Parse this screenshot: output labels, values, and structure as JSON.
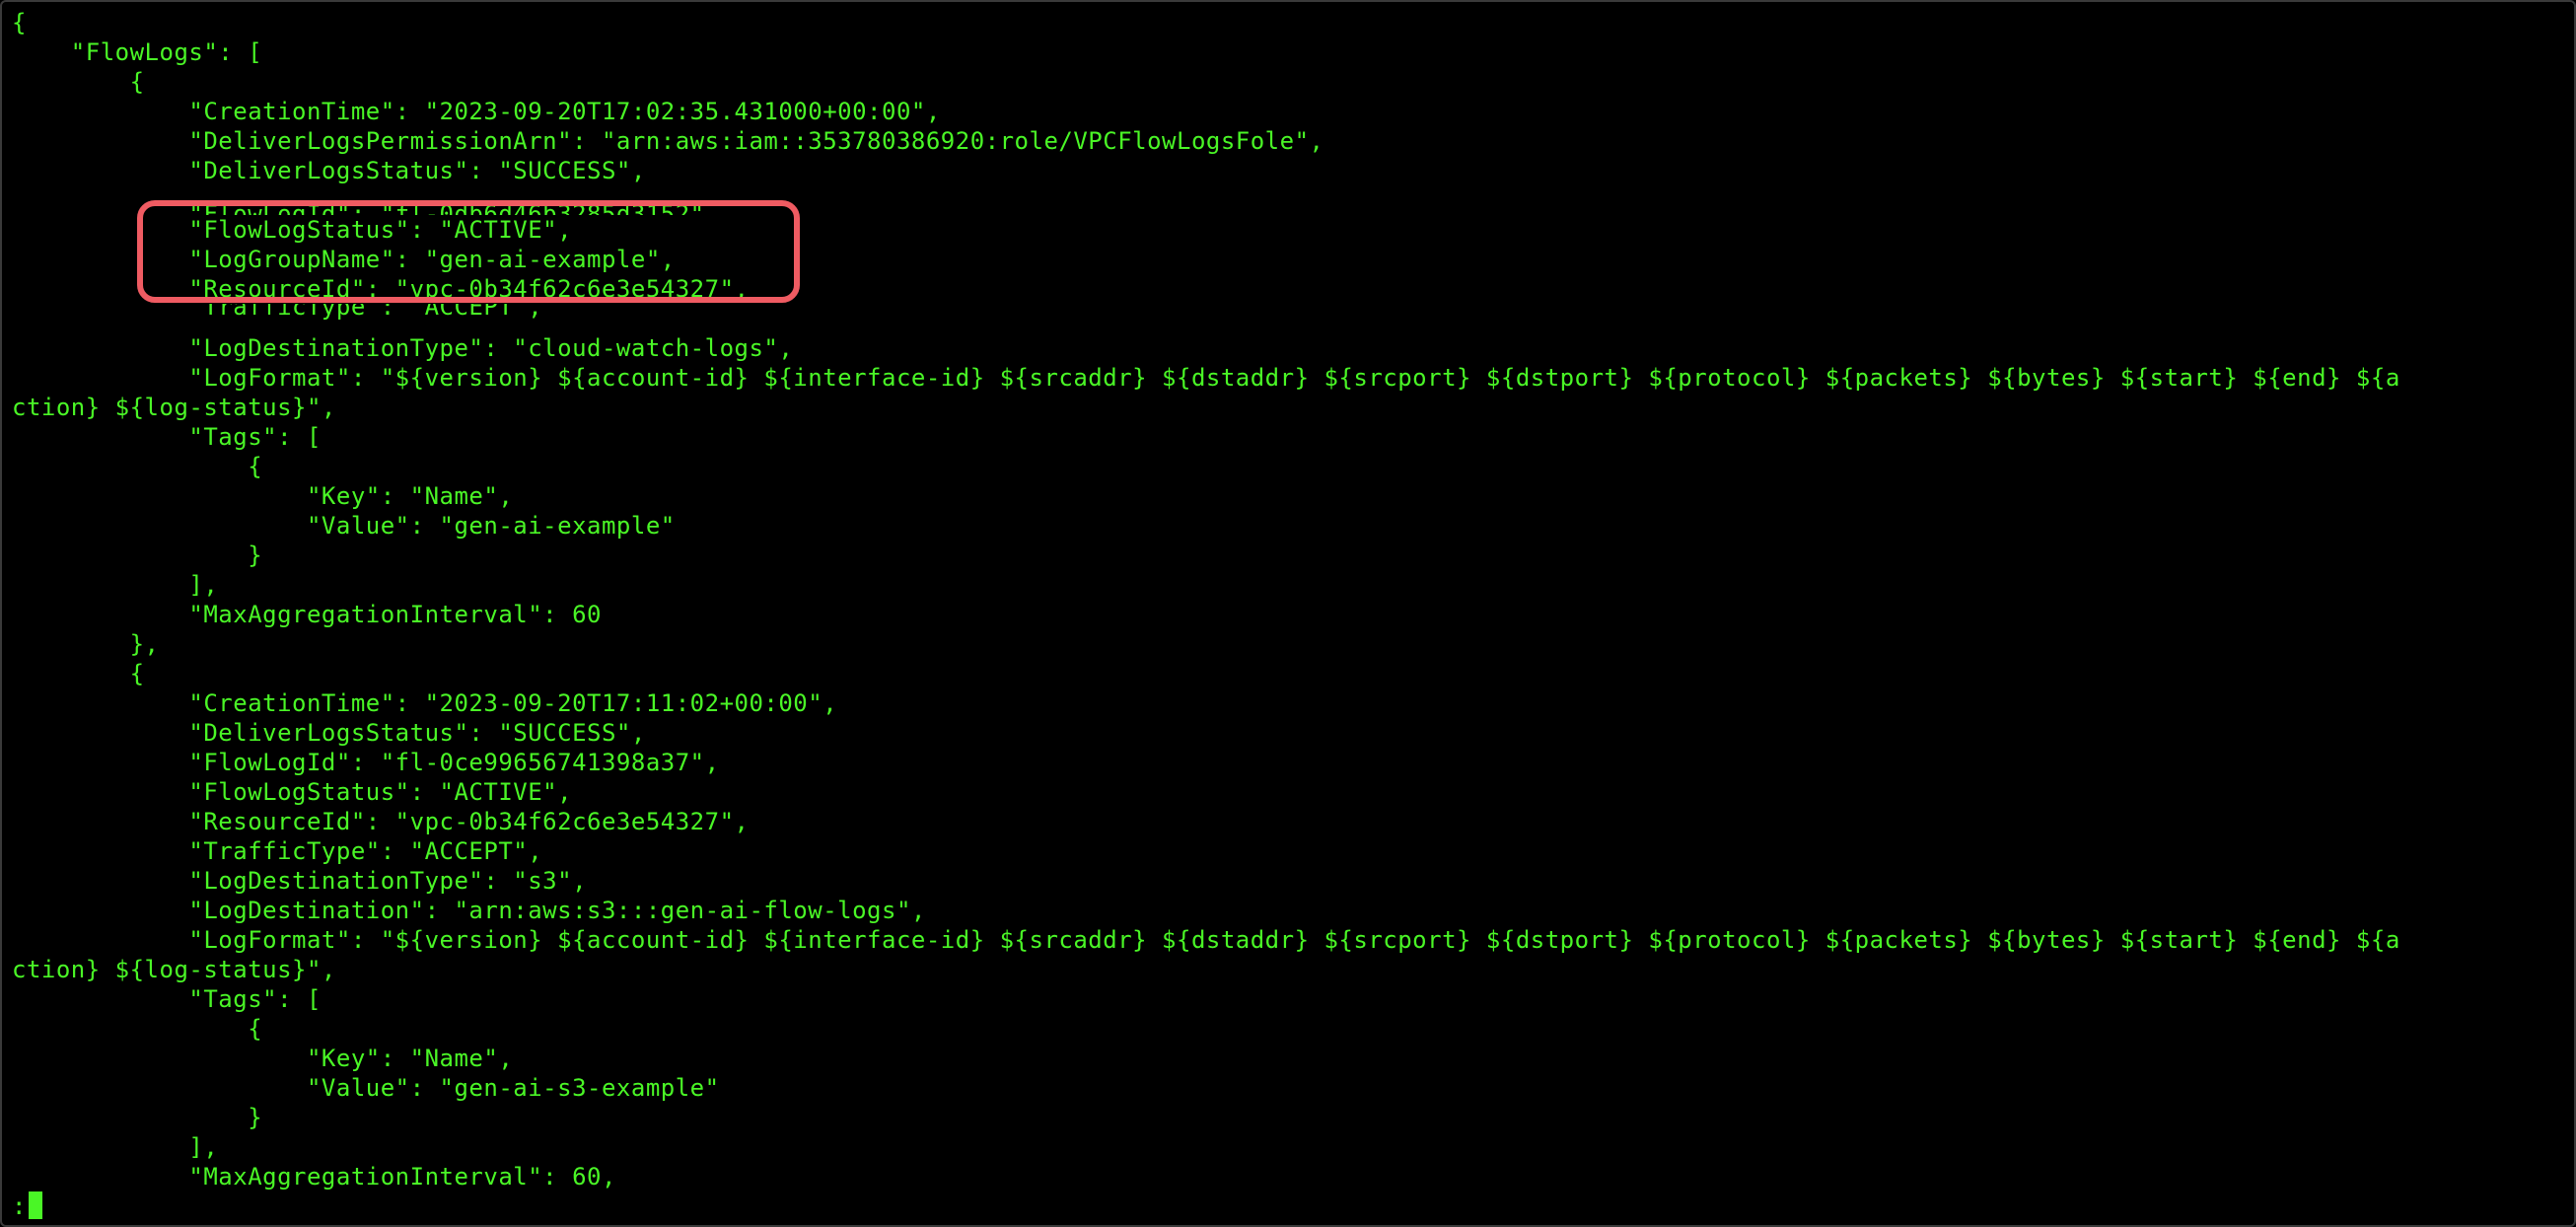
{
  "colors": {
    "terminal_bg": "#000000",
    "terminal_fg": "#4af626",
    "annotation_border": "#ef5b62"
  },
  "terminal": {
    "lines": [
      "{",
      "    \"FlowLogs\": [",
      "        {",
      "            \"CreationTime\": \"2023-09-20T17:02:35.431000+00:00\",",
      "            \"DeliverLogsPermissionArn\": \"arn:aws:iam::353780386920:role/VPCFlowLogsFole\",",
      "            \"DeliverLogsStatus\": \"SUCCESS\",",
      "            \"FlowLogId\": \"fl-0db6d46b3285d3152\",",
      "            \"FlowLogStatus\": \"ACTIVE\",",
      "            \"LogGroupName\": \"gen-ai-example\",",
      "            \"ResourceId\": \"vpc-0b34f62c6e3e54327\",",
      "            \"TrafficType\": \"ACCEPT\",",
      "            \"LogDestinationType\": \"cloud-watch-logs\",",
      "            \"LogFormat\": \"${version} ${account-id} ${interface-id} ${srcaddr} ${dstaddr} ${srcport} ${dstport} ${protocol} ${packets} ${bytes} ${start} ${end} ${a",
      "ction} ${log-status}\",",
      "            \"Tags\": [",
      "                {",
      "                    \"Key\": \"Name\",",
      "                    \"Value\": \"gen-ai-example\"",
      "                }",
      "            ],",
      "            \"MaxAggregationInterval\": 60",
      "        },",
      "        {",
      "            \"CreationTime\": \"2023-09-20T17:11:02+00:00\",",
      "            \"DeliverLogsStatus\": \"SUCCESS\",",
      "            \"FlowLogId\": \"fl-0ce99656741398a37\",",
      "            \"FlowLogStatus\": \"ACTIVE\",",
      "            \"ResourceId\": \"vpc-0b34f62c6e3e54327\",",
      "            \"TrafficType\": \"ACCEPT\",",
      "            \"LogDestinationType\": \"s3\",",
      "            \"LogDestination\": \"arn:aws:s3:::gen-ai-flow-logs\",",
      "            \"LogFormat\": \"${version} ${account-id} ${interface-id} ${srcaddr} ${dstaddr} ${srcport} ${dstport} ${protocol} ${packets} ${bytes} ${start} ${end} ${a",
      "ction} ${log-status}\",",
      "            \"Tags\": [",
      "                {",
      "                    \"Key\": \"Name\",",
      "                    \"Value\": \"gen-ai-s3-example\"",
      "                }",
      "            ],",
      "            \"MaxAggregationInterval\": 60,"
    ],
    "prompt": ":"
  }
}
